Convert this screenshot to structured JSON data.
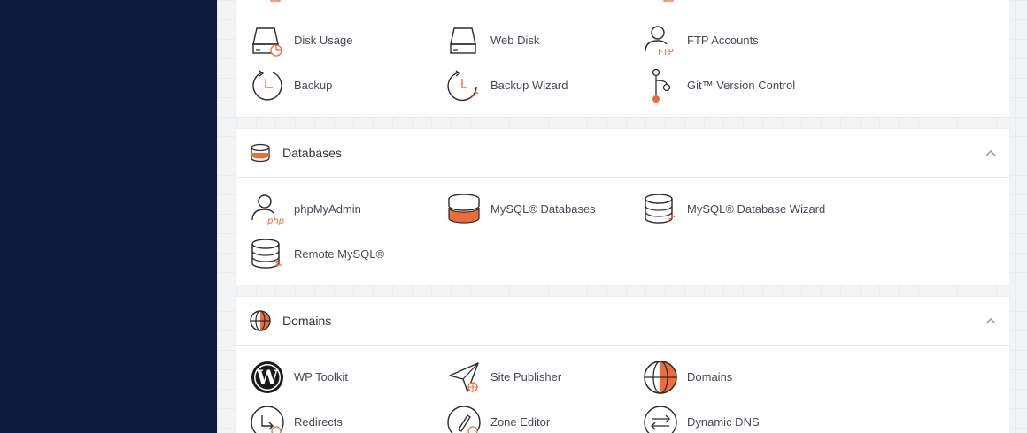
{
  "colors": {
    "sidebar": "#0b1a3d",
    "accent": "#ee6c3a",
    "icon_stroke": "#2b2b2b",
    "highlight": "#d0202a"
  },
  "files": {
    "items": [
      {
        "label": "Disk Usage",
        "icon": "disk-usage-icon"
      },
      {
        "label": "Web Disk",
        "icon": "web-disk-icon"
      },
      {
        "label": "FTP Accounts",
        "icon": "ftp-accounts-icon"
      },
      {
        "label": "Backup",
        "icon": "backup-icon"
      },
      {
        "label": "Backup Wizard",
        "icon": "backup-wizard-icon"
      },
      {
        "label": "Git™ Version Control",
        "icon": "git-icon"
      }
    ]
  },
  "databases": {
    "title": "Databases",
    "items": [
      {
        "label": "phpMyAdmin",
        "icon": "phpmyadmin-icon",
        "icon_text": "php"
      },
      {
        "label": "MySQL® Databases",
        "icon": "mysql-databases-icon"
      },
      {
        "label": "MySQL® Database Wizard",
        "icon": "mysql-wizard-icon"
      },
      {
        "label": "Remote MySQL®",
        "icon": "remote-mysql-icon"
      }
    ]
  },
  "domains": {
    "title": "Domains",
    "items": [
      {
        "label": "WP Toolkit",
        "icon": "wordpress-icon"
      },
      {
        "label": "Site Publisher",
        "icon": "site-publisher-icon"
      },
      {
        "label": "Domains",
        "icon": "globe-icon"
      },
      {
        "label": "Redirects",
        "icon": "redirects-icon"
      },
      {
        "label": "Zone Editor",
        "icon": "zone-editor-icon"
      },
      {
        "label": "Dynamic DNS",
        "icon": "dynamic-dns-icon"
      }
    ]
  }
}
